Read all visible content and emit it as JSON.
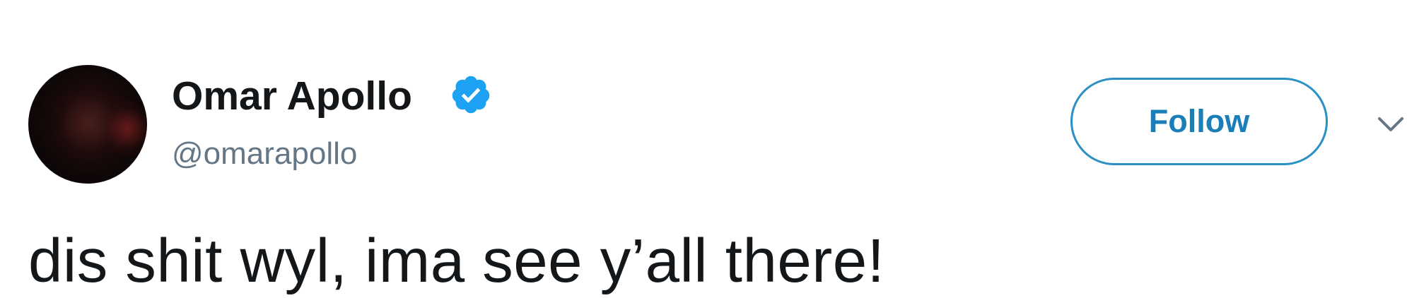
{
  "author": {
    "display_name": "Omar Apollo",
    "handle": "@omarapollo",
    "verified": true,
    "avatar_icon": "avatar-photo"
  },
  "actions": {
    "follow_label": "Follow",
    "more_icon": "chevron-down-icon"
  },
  "tweet": {
    "text": "dis shit wyl, ima see y’all there!"
  },
  "colors": {
    "name_text": "#14171a",
    "handle_text": "#657786",
    "accent": "#1b95e0",
    "verified_badge": "#1da1f2",
    "background": "#ffffff"
  }
}
